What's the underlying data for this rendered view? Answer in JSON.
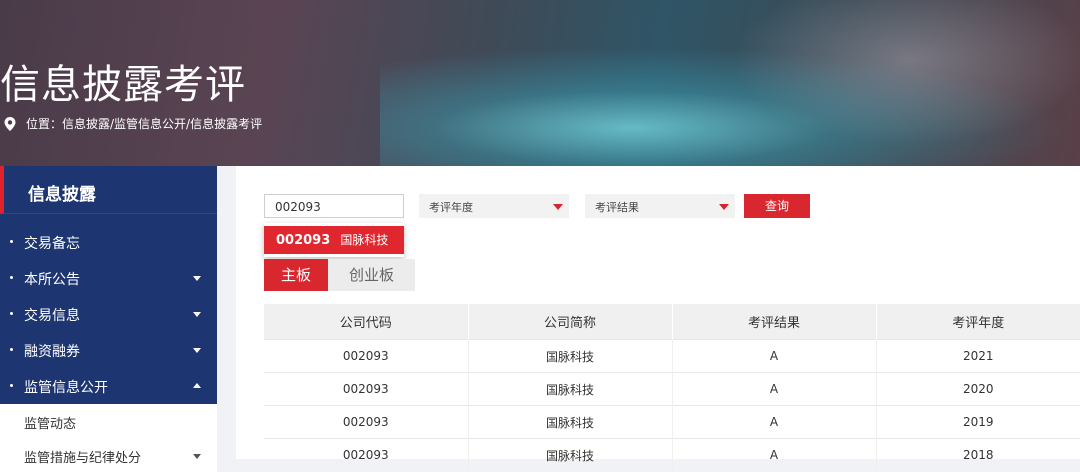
{
  "banner": {
    "title": "信息披露考评",
    "breadcrumb": "位置：信息披露/监管信息公开/信息披露考评"
  },
  "sidebar": {
    "heading": "信息披露",
    "items": [
      {
        "label": "交易备忘",
        "caret": "none"
      },
      {
        "label": "本所公告",
        "caret": "down"
      },
      {
        "label": "交易信息",
        "caret": "down"
      },
      {
        "label": "融资融券",
        "caret": "down"
      },
      {
        "label": "监管信息公开",
        "caret": "up"
      }
    ],
    "subitems": [
      {
        "label": "监管动态"
      },
      {
        "label": "监管措施与纪律处分"
      }
    ]
  },
  "filters": {
    "search_value": "002093",
    "year_placeholder": "考评年度",
    "result_placeholder": "考评结果",
    "query_label": "查询"
  },
  "suggestion": {
    "code": "002093",
    "name": "国脉科技"
  },
  "tabs": [
    {
      "label": "主板",
      "active": true
    },
    {
      "label": "创业板",
      "active": false
    }
  ],
  "table": {
    "headers": [
      "公司代码",
      "公司简称",
      "考评结果",
      "考评年度"
    ],
    "rows": [
      [
        "002093",
        "国脉科技",
        "A",
        "2021"
      ],
      [
        "002093",
        "国脉科技",
        "A",
        "2020"
      ],
      [
        "002093",
        "国脉科技",
        "A",
        "2019"
      ],
      [
        "002093",
        "国脉科技",
        "A",
        "2018"
      ]
    ]
  },
  "colors": {
    "accent": "#d9272f",
    "sidebar": "#1d3570"
  }
}
